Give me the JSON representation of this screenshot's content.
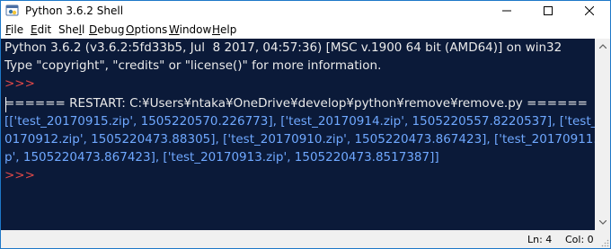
{
  "window": {
    "title": "Python 3.6.2 Shell",
    "minimize_icon": "minimize-icon",
    "maximize_icon": "maximize-icon",
    "close_icon": "close-icon",
    "frame_color": "#1e78c8"
  },
  "menu": {
    "items": [
      {
        "key": "F",
        "rest": "ile"
      },
      {
        "key": "E",
        "rest": "dit"
      },
      {
        "key": "",
        "pre": "She",
        "key2": "l",
        "rest": "l"
      },
      {
        "key": "D",
        "rest": "ebug"
      },
      {
        "key": "O",
        "rest": "ptions"
      },
      {
        "key": "W",
        "rest": "indow"
      },
      {
        "key": "H",
        "rest": "elp"
      }
    ]
  },
  "shell": {
    "background": "#0b1a39",
    "prompt_color": "#e04848",
    "result_color": "#6fa8ff",
    "banner_line1": "Python 3.6.2 (v3.6.2:5fd33b5, Jul  8 2017, 04:57:36) [MSC v.1900 64 bit (AMD64)] on win32",
    "banner_line2": "Type \"copyright\", \"credits\" or \"license()\" for more information.",
    "prompt1": ">>> ",
    "restart_line": "====== RESTART: C:¥Users¥ntaka¥OneDrive¥develop¥python¥remove¥remove.py ======",
    "result_line1": "[['test_20170915.zip', 1505220570.226773], ['test_20170914.zip', 1505220557.8220537], ['test_2",
    "result_line2": "0170912.zip', 1505220473.88305], ['test_20170910.zip', 1505220473.867423], ['test_20170911.zi",
    "result_line3": "p', 1505220473.867423], ['test_20170913.zip', 1505220473.8517387]]",
    "prompt2": ">>> "
  },
  "status": {
    "line": "Ln: 4",
    "col": "Col: 0"
  }
}
